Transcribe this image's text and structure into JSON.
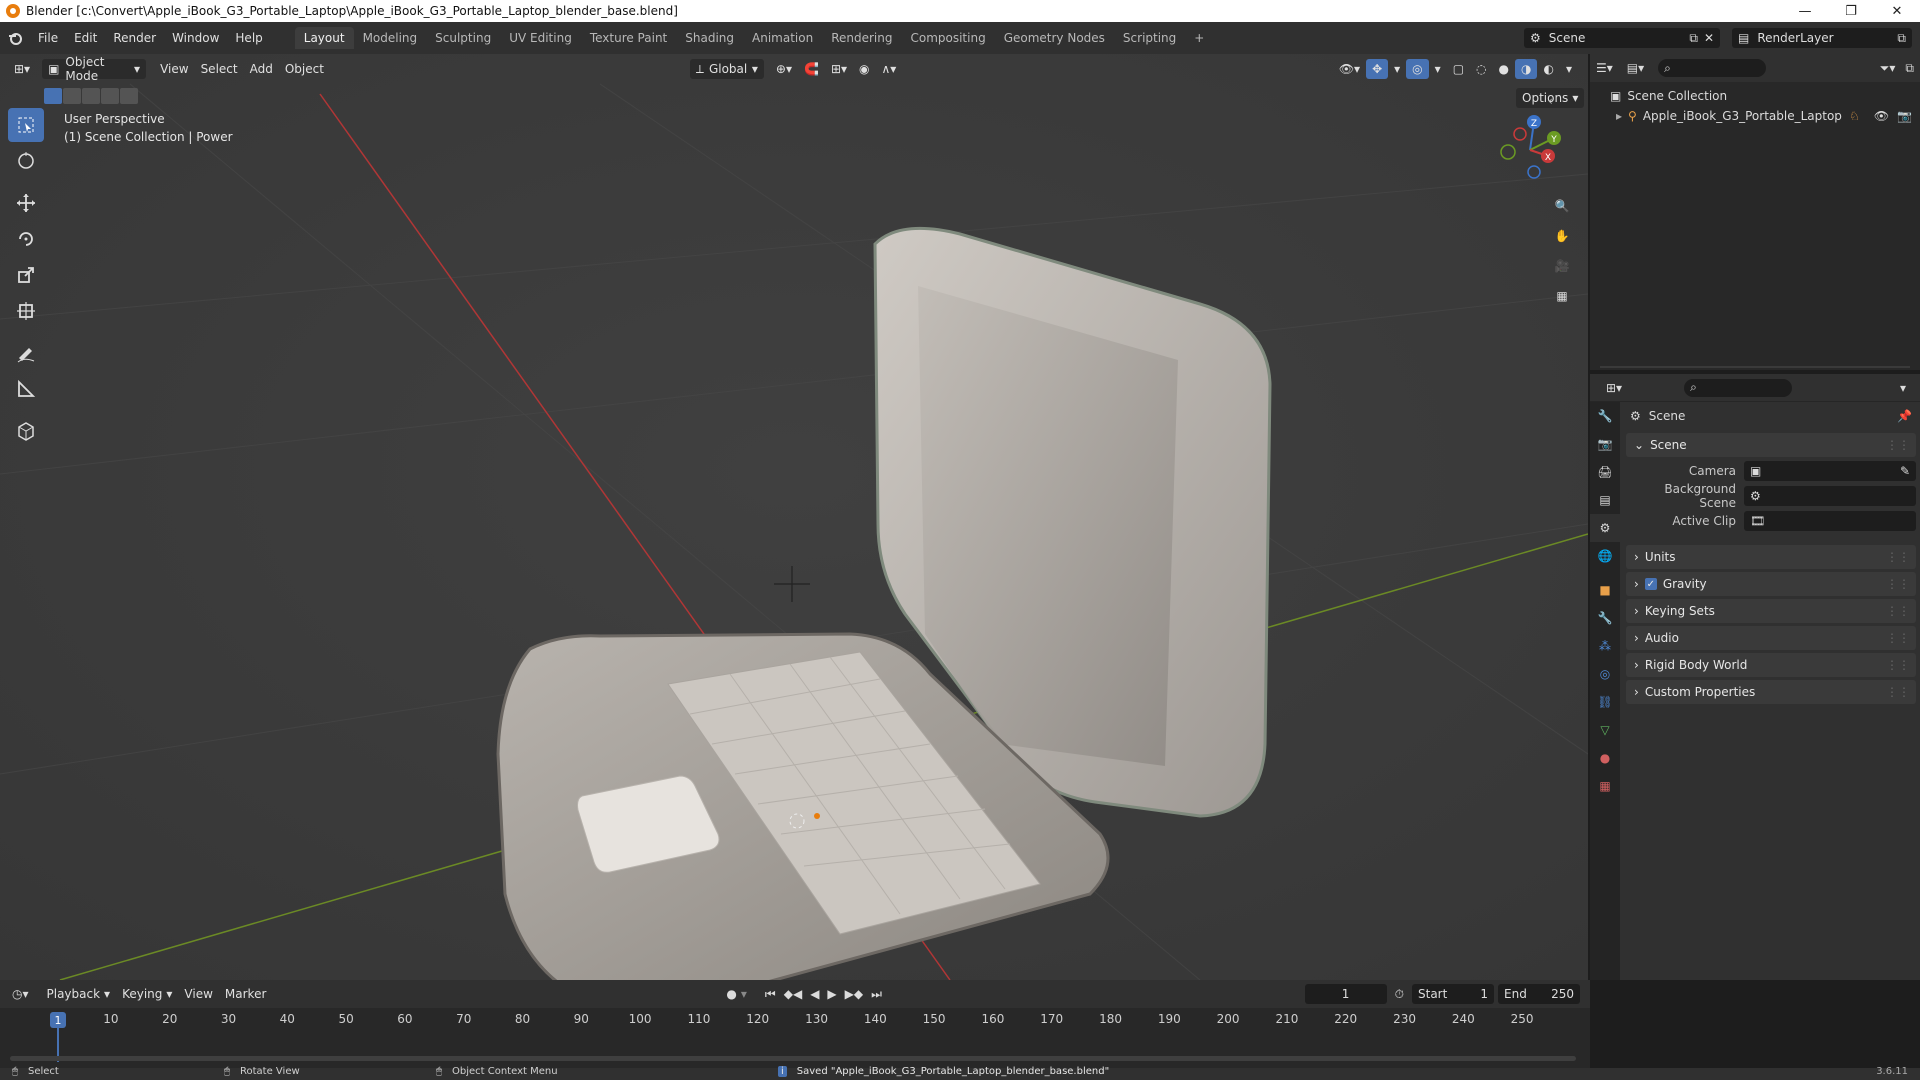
{
  "window": {
    "title": "Blender [c:\\Convert\\Apple_iBook_G3_Portable_Laptop\\Apple_iBook_G3_Portable_Laptop_blender_base.blend]",
    "minimize": "—",
    "maximize": "❐",
    "close": "✕"
  },
  "menus": [
    "File",
    "Edit",
    "Render",
    "Window",
    "Help"
  ],
  "workspaces": [
    "Layout",
    "Modeling",
    "Sculpting",
    "UV Editing",
    "Texture Paint",
    "Shading",
    "Animation",
    "Rendering",
    "Compositing",
    "Geometry Nodes",
    "Scripting"
  ],
  "active_workspace": "Layout",
  "add_workspace": "+",
  "scene_selector": "Scene",
  "view_layer_selector": "RenderLayer",
  "viewport": {
    "mode": "Object Mode",
    "menus": [
      "View",
      "Select",
      "Add",
      "Object"
    ],
    "orientation": "Global",
    "options": "Options",
    "info_line1": "User Perspective",
    "info_line2": "(1) Scene Collection | Power",
    "gizmo_axes": [
      "Z",
      "Y",
      "X"
    ]
  },
  "outliner": {
    "root": "Scene Collection",
    "item": "Apple_iBook_G3_Portable_Laptop"
  },
  "properties": {
    "title": "Scene",
    "panel": "Scene",
    "fields": [
      {
        "label": "Camera",
        "value": ""
      },
      {
        "label": "Background Scene",
        "value": ""
      },
      {
        "label": "Active Clip",
        "value": ""
      }
    ],
    "collapsed_panels": [
      "Units",
      "Gravity",
      "Keying Sets",
      "Audio",
      "Rigid Body World",
      "Custom Properties"
    ],
    "gravity_checked": true
  },
  "timeline": {
    "menus": [
      "Playback",
      "Keying",
      "View",
      "Marker"
    ],
    "current_frame": "1",
    "start_label": "Start",
    "start": "1",
    "end_label": "End",
    "end": "250",
    "ticks": [
      "10",
      "20",
      "30",
      "40",
      "50",
      "60",
      "70",
      "80",
      "90",
      "100",
      "110",
      "120",
      "130",
      "140",
      "150",
      "160",
      "170",
      "180",
      "190",
      "200",
      "210",
      "220",
      "230",
      "240",
      "250"
    ],
    "playhead": "1"
  },
  "statusbar": {
    "select": "Select",
    "rotate": "Rotate View",
    "context": "Object Context Menu",
    "message": "Saved \"Apple_iBook_G3_Portable_Laptop_blender_base.blend\"",
    "version": "3.6.11"
  },
  "colors": {
    "accent": "#4772b3",
    "x_axis": "#c93a3a",
    "y_axis": "#6b9b23",
    "z_axis": "#3b73c9",
    "orange": "#e87d0d"
  }
}
